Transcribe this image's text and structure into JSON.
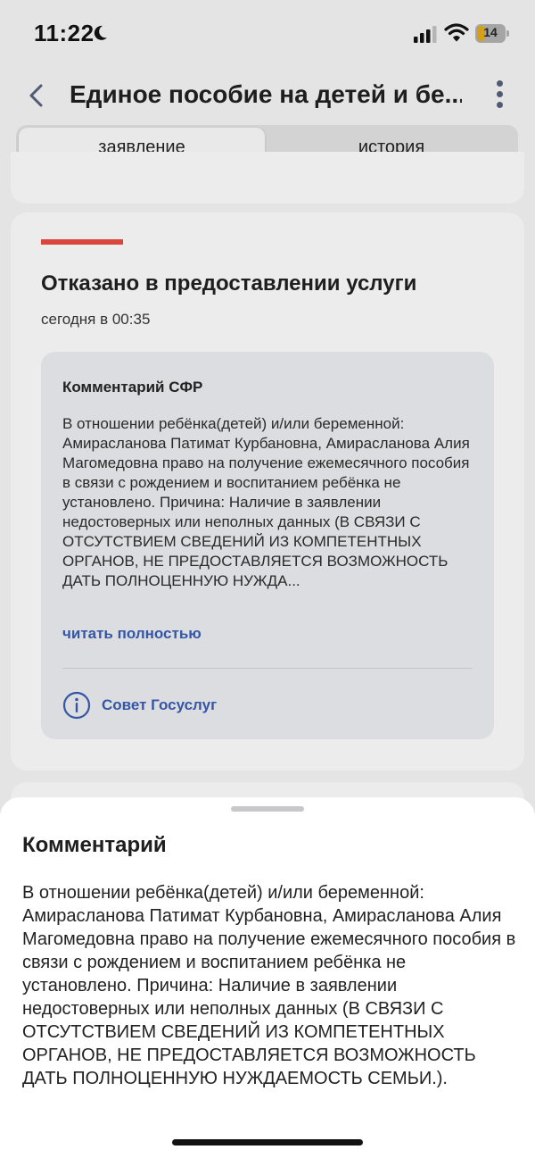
{
  "status_bar": {
    "time": "11:22",
    "battery": "14",
    "icons": [
      "moon-icon",
      "signal-icon",
      "wifi-icon",
      "battery-icon"
    ]
  },
  "header": {
    "title": "Единое пособие на детей и бе...",
    "icons": [
      "back-arrow-icon",
      "more-vertical-icon"
    ]
  },
  "tabs": [
    {
      "label": "заявление",
      "active": true
    },
    {
      "label": "история",
      "active": false
    }
  ],
  "status_card": {
    "accent_color": "#d9473c",
    "heading": "Отказано в предоставлении услуги",
    "time": "сегодня в 00:35",
    "comment": {
      "title": "Комментарий СФР",
      "text": "В отношении ребёнка(детей) и/или беременной: Амирасланова Патимат Курбановна, Амирасланова Алия Магомедовна право на получение ежемесячного пособия в связи с рождением и воспитанием ребёнка не установлено. Причина: Наличие в заявлении недостоверных или неполных данных (В СВЯЗИ С ОТСУТСТВИЕМ СВЕДЕНИЙ ИЗ КОМПЕТЕНТНЫХ ОРГАНОВ, НЕ ПРЕДОСТАВЛЯЕТСЯ ВОЗМОЖНОСТЬ ДАТЬ ПОЛНОЦЕННУЮ НУЖДА...",
      "read_more": "читать полностью",
      "advice": "Совет Госуслуг",
      "link_color": "#3556a7"
    }
  },
  "sheet": {
    "title": "Комментарий",
    "text": "В отношении ребёнка(детей) и/или беременной: Амирасланова Патимат Курбановна, Амирасланова Алия Магомедовна право на получение ежемесячного пособия в связи с рождением и воспитанием ребёнка не установлено. Причина: Наличие в заявлении недостоверных или неполных данных (В СВЯЗИ С ОТСУТСТВИЕМ СВЕДЕНИЙ ИЗ КОМПЕТЕНТНЫХ ОРГАНОВ, НЕ ПРЕДОСТАВЛЯЕТСЯ ВОЗМОЖНОСТЬ ДАТЬ ПОЛНОЦЕННУЮ НУЖДАЕМОСТЬ СЕМЬИ.)."
  }
}
